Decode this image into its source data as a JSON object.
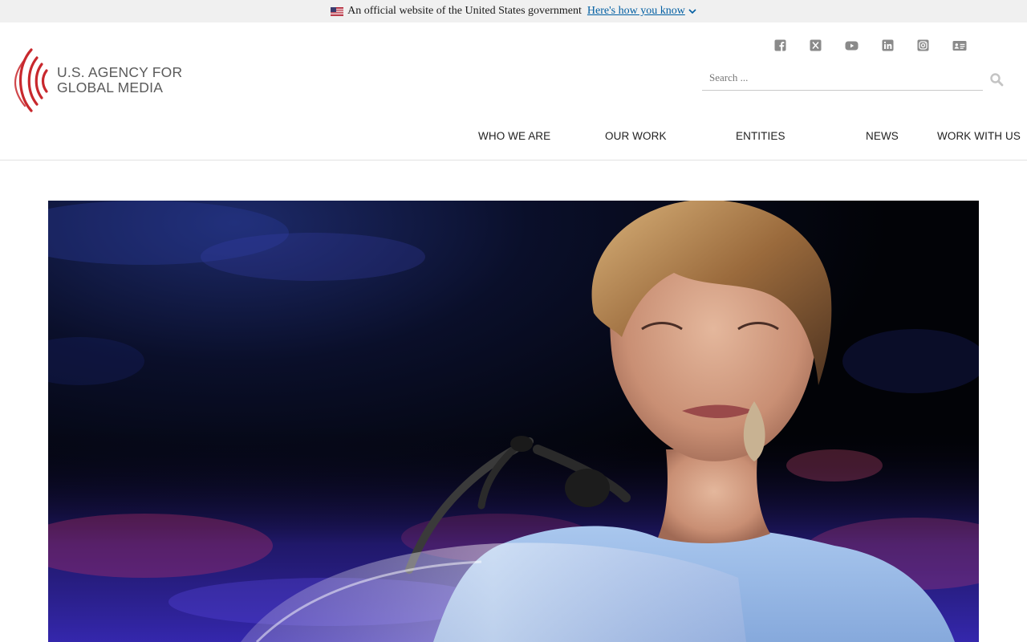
{
  "gov_banner": {
    "text": "An official website of the United States government",
    "link_label": "Here's how you know"
  },
  "logo": {
    "line1": "U.S. AGENCY FOR",
    "line2": "GLOBAL MEDIA"
  },
  "social": [
    "facebook-icon",
    "x-icon",
    "youtube-icon",
    "linkedin-icon",
    "instagram-icon",
    "contact-card-icon"
  ],
  "search": {
    "placeholder": "Search ..."
  },
  "nav": {
    "items": [
      {
        "label": "WHO WE ARE"
      },
      {
        "label": "OUR WORK"
      },
      {
        "label": "ENTITIES"
      },
      {
        "label": "NEWS"
      },
      {
        "label": "WORK WITH US"
      }
    ]
  },
  "colors": {
    "brand_red": "#c8282d",
    "link_blue": "#005ea2",
    "banner_bg": "#f0f0f0"
  }
}
